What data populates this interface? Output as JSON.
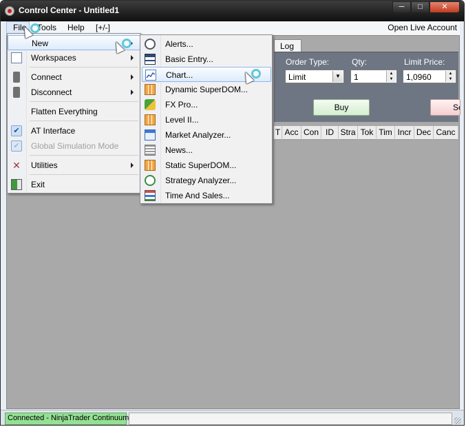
{
  "window": {
    "title": "Control Center - Untitled1",
    "controls": {
      "minimize": "─",
      "maximize": "□",
      "close": "✕"
    }
  },
  "menubar": {
    "items": [
      "File",
      "Tools",
      "Help",
      "[+/-]"
    ],
    "right_link": "Open Live Account"
  },
  "file_menu": {
    "items": [
      {
        "label": "New",
        "icon": "new-icon",
        "submenu": true,
        "highlighted": true
      },
      {
        "label": "Workspaces",
        "icon": "workspaces-icon",
        "submenu": true
      },
      {
        "label": "Connect",
        "icon": "connect-icon",
        "submenu": true
      },
      {
        "label": "Disconnect",
        "icon": "disconnect-icon",
        "submenu": true
      },
      {
        "label": "Flatten Everything",
        "icon": ""
      },
      {
        "label": "AT Interface",
        "icon": "check-icon",
        "checked": true
      },
      {
        "label": "Global Simulation Mode",
        "icon": "check-icon",
        "checked": true,
        "disabled": true
      },
      {
        "label": "Utilities",
        "icon": "utilities-icon",
        "submenu": true
      },
      {
        "label": "Exit",
        "icon": "exit-icon"
      }
    ]
  },
  "new_menu": {
    "items": [
      {
        "label": "Alerts...",
        "icon": "alarm-clock-icon"
      },
      {
        "label": "Basic Entry...",
        "icon": "basic-entry-icon"
      },
      {
        "label": "Chart...",
        "icon": "chart-icon",
        "highlighted": true
      },
      {
        "label": "Dynamic SuperDOM...",
        "icon": "superdom-icon"
      },
      {
        "label": "FX Pro...",
        "icon": "fx-pro-icon"
      },
      {
        "label": "Level II...",
        "icon": "level-two-icon"
      },
      {
        "label": "Market Analyzer...",
        "icon": "market-analyzer-icon"
      },
      {
        "label": "News...",
        "icon": "news-icon"
      },
      {
        "label": "Static SuperDOM...",
        "icon": "static-superdom-icon"
      },
      {
        "label": "Strategy Analyzer...",
        "icon": "strategy-analyzer-icon"
      },
      {
        "label": "Time And Sales...",
        "icon": "time-and-sales-icon"
      }
    ]
  },
  "order_panel": {
    "tab": "Log",
    "order_type_label": "Order Type:",
    "order_type_value": "Limit",
    "qty_label": "Qty:",
    "qty_value": "1",
    "limit_price_label": "Limit Price:",
    "limit_price_value": "1,0960",
    "buy_label": "Buy",
    "sell_label": "Se"
  },
  "grid": {
    "columns": [
      "T",
      "Acc",
      "Con",
      "ID",
      "Stra",
      "Tok",
      "Tim",
      "Incr",
      "Dec",
      "Canc"
    ]
  },
  "statusbar": {
    "connection": "Connected - NinjaTrader Continuum"
  },
  "colors": {
    "status_connected": "#94e094",
    "menu_highlight": "#ddebfb",
    "order_panel": "#6e7683"
  }
}
